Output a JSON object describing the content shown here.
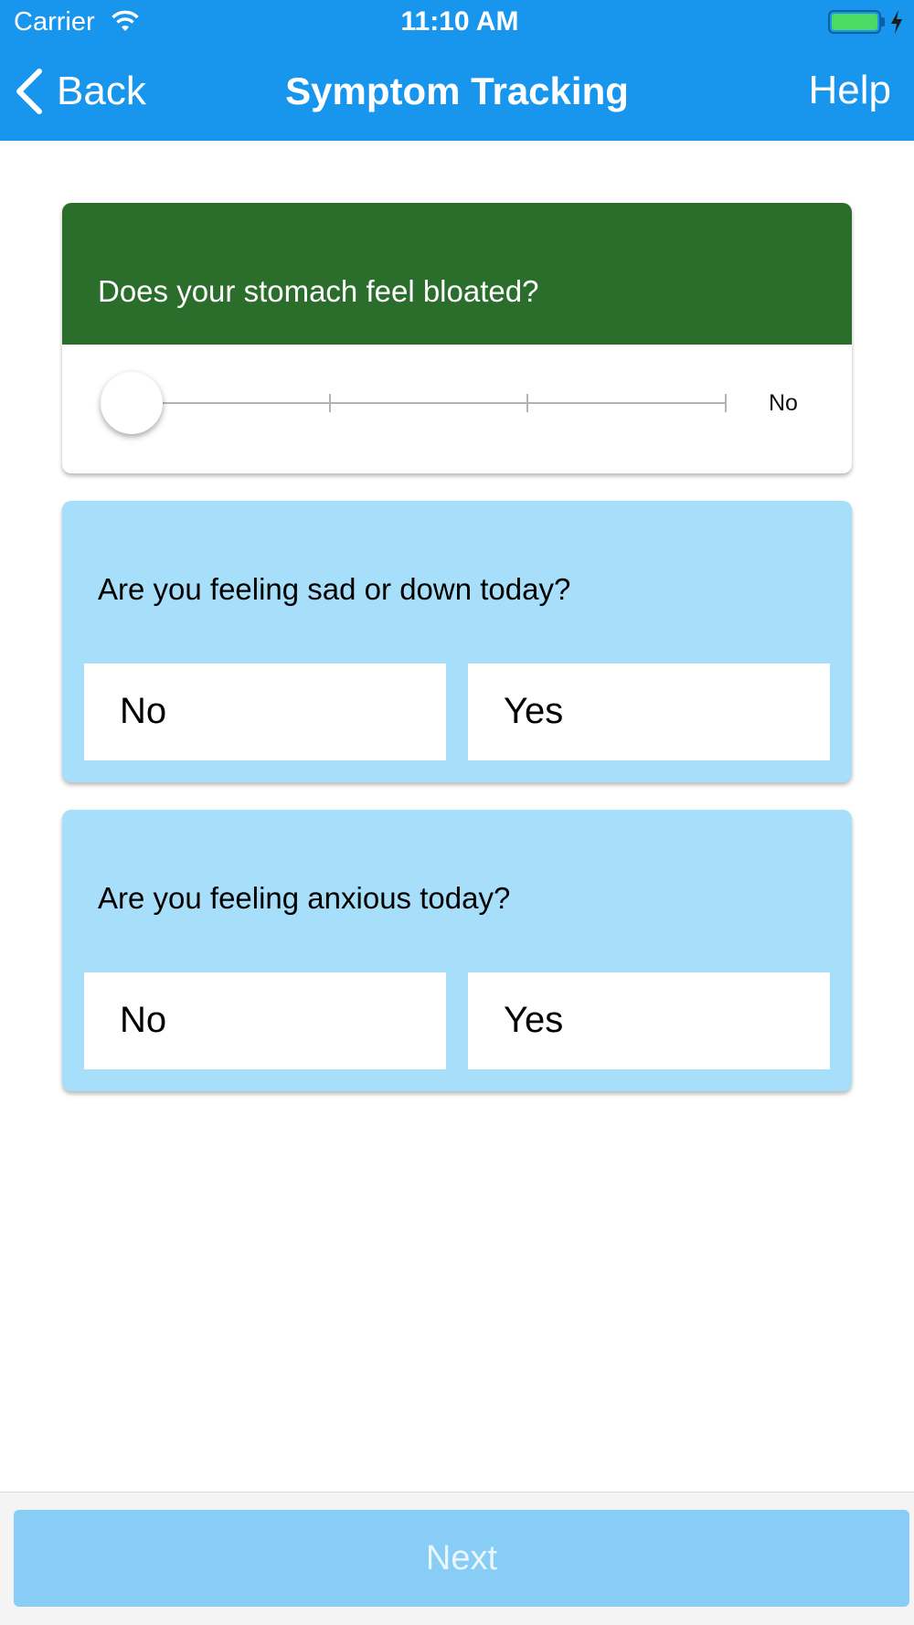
{
  "status_bar": {
    "carrier": "Carrier",
    "time": "11:10 AM",
    "wifi_icon": "wifi-icon",
    "battery_icon": "battery-icon",
    "charging_icon": "bolt-icon"
  },
  "nav": {
    "back_label": "Back",
    "back_icon": "chevron-left-icon",
    "title": "Symptom Tracking",
    "help_label": "Help"
  },
  "questions": {
    "bloated": {
      "text": "Does your stomach feel bloated?",
      "value_label": "No",
      "slider_level": 0,
      "slider_steps": 4
    },
    "sad": {
      "text": "Are you feeling sad or down today?",
      "no_label": "No",
      "yes_label": "Yes"
    },
    "anxious": {
      "text": "Are you feeling anxious today?",
      "no_label": "No",
      "yes_label": "Yes"
    }
  },
  "footer": {
    "next_label": "Next"
  },
  "colors": {
    "header": "#1896EE",
    "slider_card_header": "#2B6E2B",
    "binary_card_bg": "#A7DFFA",
    "next_button_bg": "#88CDF5",
    "battery_fill": "#4CD964"
  }
}
